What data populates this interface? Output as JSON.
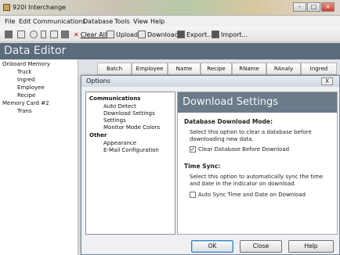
{
  "window": {
    "title": "920i Interchange"
  },
  "menu": [
    "File",
    "Edit",
    "Communications",
    "Database",
    "Tools",
    "View",
    "Help"
  ],
  "toolbar": {
    "clear_all": "Clear All",
    "upload": "Upload",
    "download": "Download",
    "export": "Export...",
    "import": "Import..."
  },
  "header": {
    "title": "Data Editor"
  },
  "tree": {
    "items": [
      "Onboard Memory",
      "Truck",
      "Ingred",
      "Employee",
      "Recipe",
      "Memory Card #2",
      "Trans"
    ]
  },
  "grid": {
    "columns": [
      "Batch",
      "Employee",
      "Name",
      "Recipe",
      "RName",
      "RAnaly",
      "Ingred"
    ]
  },
  "dialog": {
    "title": "Options",
    "close": "X",
    "tree": [
      "Communications",
      "Auto Detect",
      "Download Settings",
      "Settings",
      "Monitor Mode Colors",
      "Other",
      "Appearance",
      "E-Mail Configuration"
    ],
    "panel_title": "Download Settings",
    "db_heading": "Database Download Mode:",
    "db_desc_1": "Select this option to clear a database before",
    "db_desc_2": "downloading new data.",
    "db_checkbox": "Clear Database Before Download",
    "db_checked": true,
    "sync_heading": "Time Sync:",
    "sync_desc_1": "Select this option to automatically sync the time",
    "sync_desc_2": "and date in the indicator on download.",
    "sync_checkbox": "Auto Sync Time and Date on Download",
    "sync_checked": false,
    "ok": "OK",
    "cancel": "Close",
    "help": "Help"
  }
}
